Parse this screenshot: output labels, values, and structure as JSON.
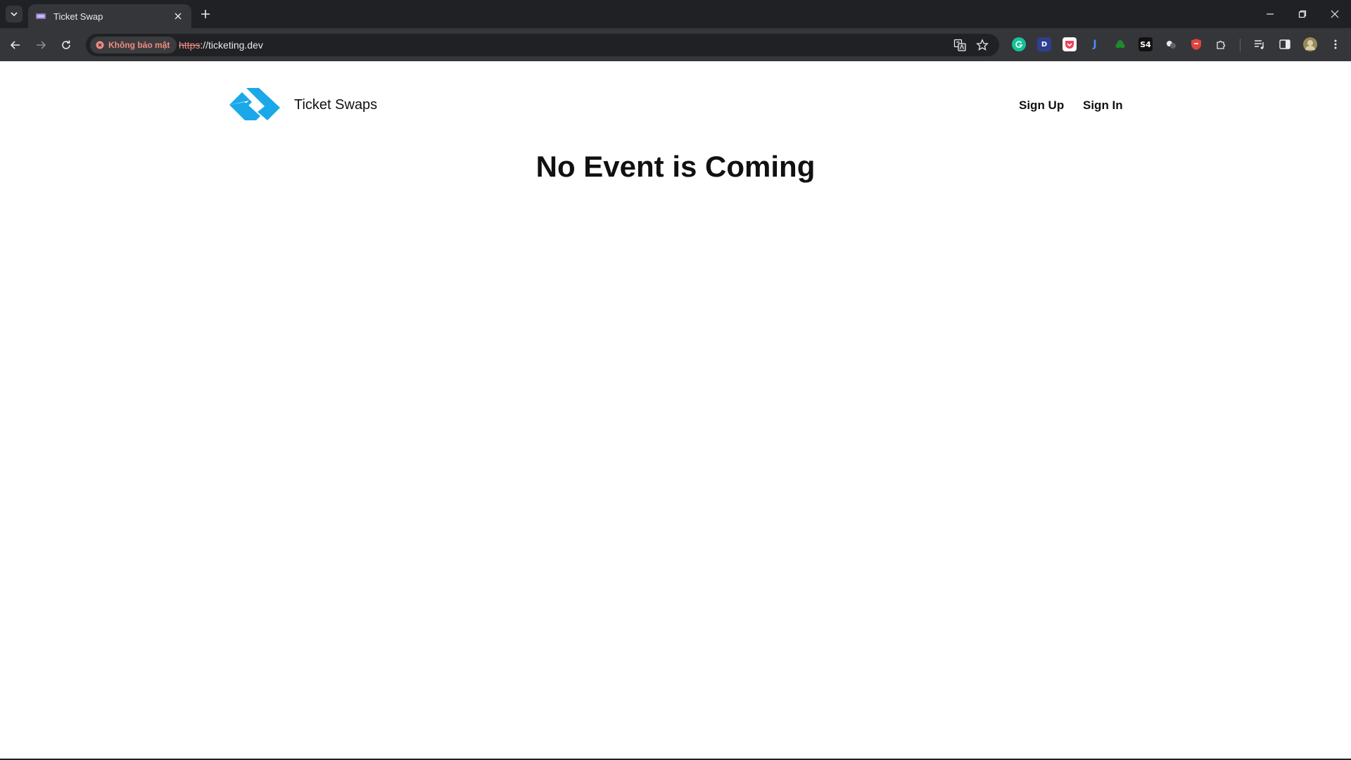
{
  "browser": {
    "tab_title": "Ticket Swap",
    "security_label": "Không bảo mật",
    "url_scheme": "https",
    "url_rest": "://ticketing.dev",
    "extensions": [
      "grammarly-icon",
      "d-extension-icon",
      "pocket-icon",
      "j-extension-icon",
      "green-leaf-icon",
      "s4-extension-icon",
      "puzzle-dark-icon",
      "shield-red-icon",
      "extensions-puzzle-icon"
    ],
    "ext_s4_label": "S4",
    "ext_d_label": "D",
    "ext_j_label": "J",
    "colors": {
      "tabstrip": "#202124",
      "toolbar": "#35363a",
      "warning": "#f28b82"
    }
  },
  "site": {
    "brand_name": "Ticket Swaps",
    "logo_color": "#1aa8e8",
    "nav": {
      "sign_up": "Sign Up",
      "sign_in": "Sign In"
    },
    "headline": "No Event is Coming"
  }
}
